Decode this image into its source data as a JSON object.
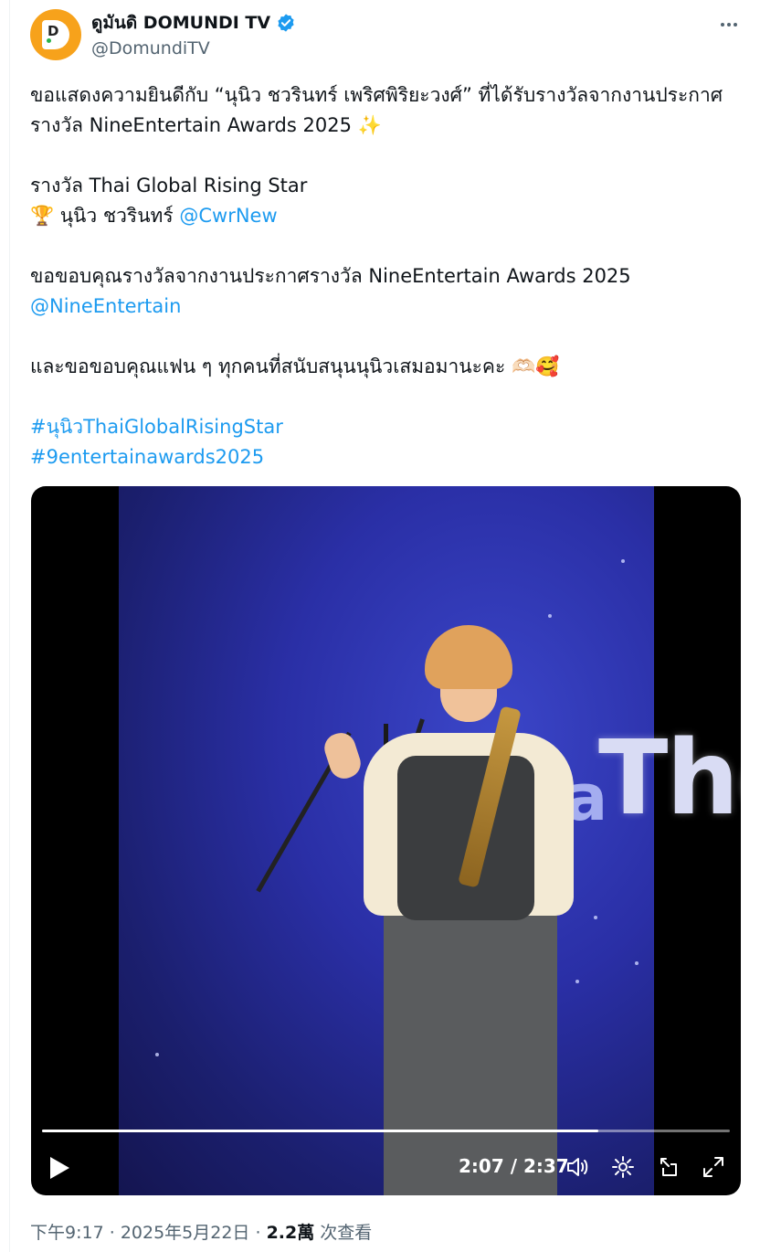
{
  "author": {
    "display_name": "ดูมันดิ DOMUNDI TV",
    "handle": "@DomundiTV",
    "avatar_glyph": "D",
    "verified": true
  },
  "tweet": {
    "line1": "ขอแสดงความยินดีกับ “นุนิว ชวรินทร์ เพริศพิริยะวงศ์” ที่ได้รับรางวัลจากงานประกาศ",
    "line2": "รางวัล NineEntertain Awards 2025",
    "sparkle": "✨",
    "award_name": "รางวัล Thai Global Rising Star",
    "trophy": "🏆",
    "winner_name": "นุนิว ชวรินทร์",
    "winner_mention": "@CwrNew",
    "thanks_line": "ขอขอบคุณรางวัลจากงานประกาศรางวัล NineEntertain Awards 2025",
    "organizer_mention": "@NineEntertain",
    "fans_line": "และขอขอบคุณแฟน ๆ ทุกคนที่สนับสนุนนุนิวเสมอมานะคะ",
    "fans_emoji": "🫶🏻🥰",
    "hashtag1": "#นุนิวThaiGlobalRisingStar",
    "hashtag2": "#9entertainawards2025"
  },
  "video": {
    "stage_text": "Tho",
    "stage_letter": "a",
    "current_time": "2:07",
    "duration": "2:37",
    "time_display": "2:07 / 2:37",
    "progress_fraction": 0.809
  },
  "footer": {
    "time": "下午9:17",
    "separator": "·",
    "date": "2025年5月22日",
    "views_count": "2.2萬",
    "views_label": "次查看"
  },
  "colors": {
    "link": "#1d9bf0",
    "verified": "#1d9bf0",
    "avatar_bg": "#f7a21b",
    "muted": "#536471"
  },
  "icons": [
    "verified-badge-icon",
    "more-icon",
    "play-icon",
    "volume-icon",
    "settings-icon",
    "pip-icon",
    "fullscreen-icon"
  ]
}
